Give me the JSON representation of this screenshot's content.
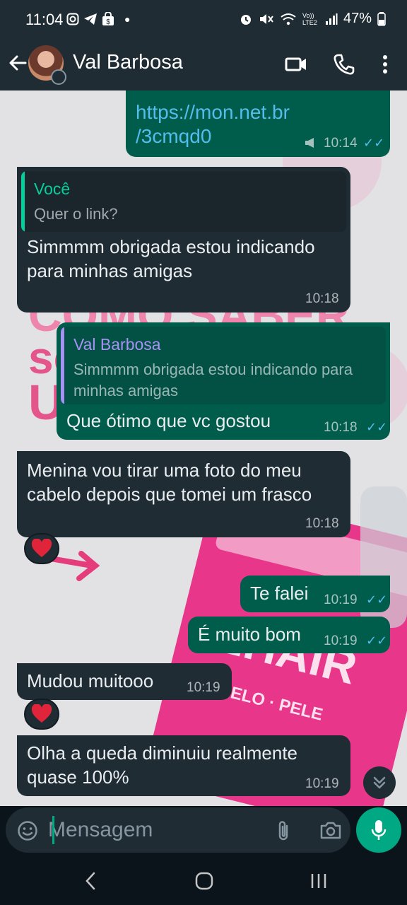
{
  "status_bar": {
    "time": "11:04",
    "battery": "47%",
    "network_label": "Vo)) LTE2"
  },
  "header": {
    "contact_name": "Val Barbosa",
    "icons": [
      "back-arrow-icon",
      "video-call-icon",
      "phone-icon",
      "more-options-icon"
    ]
  },
  "messages": [
    {
      "id": "m1",
      "direction": "out",
      "text_lines": [
        "https://mon.net.br",
        "/3cmqd0"
      ],
      "time": "10:14",
      "status": "read"
    },
    {
      "id": "m2",
      "direction": "in",
      "quote_name": "Você",
      "quote_text": "Quer o link?",
      "text": "Simmmm obrigada estou indicando para minhas amigas",
      "time": "10:18"
    },
    {
      "id": "m3",
      "direction": "out",
      "quote_name": "Val Barbosa",
      "quote_text": "Simmmm obrigada estou indicando para minhas amigas",
      "text": "Que ótimo que vc gostou",
      "time": "10:18",
      "status": "read"
    },
    {
      "id": "m4",
      "direction": "in",
      "text": "Menina vou tirar uma foto do meu cabelo depois que tomei um frasco",
      "time": "10:18",
      "reaction": "❤️"
    },
    {
      "id": "m5",
      "direction": "out",
      "text": "Te falei",
      "time": "10:19",
      "status": "read"
    },
    {
      "id": "m6",
      "direction": "out",
      "text": "É muito bom",
      "time": "10:19",
      "status": "read"
    },
    {
      "id": "m7",
      "direction": "in",
      "text": "Mudou muitooo",
      "time": "10:19",
      "reaction": "❤️"
    },
    {
      "id": "m8",
      "direction": "in",
      "text": "Olha a queda diminuiu realmente quase 100%",
      "time": "10:19"
    }
  ],
  "input": {
    "placeholder": "Mensagem"
  },
  "colors": {
    "incoming": "#1f2c34",
    "outgoing": "#005c4b",
    "accent": "#00a884",
    "read_ticks": "#53bdeb"
  }
}
